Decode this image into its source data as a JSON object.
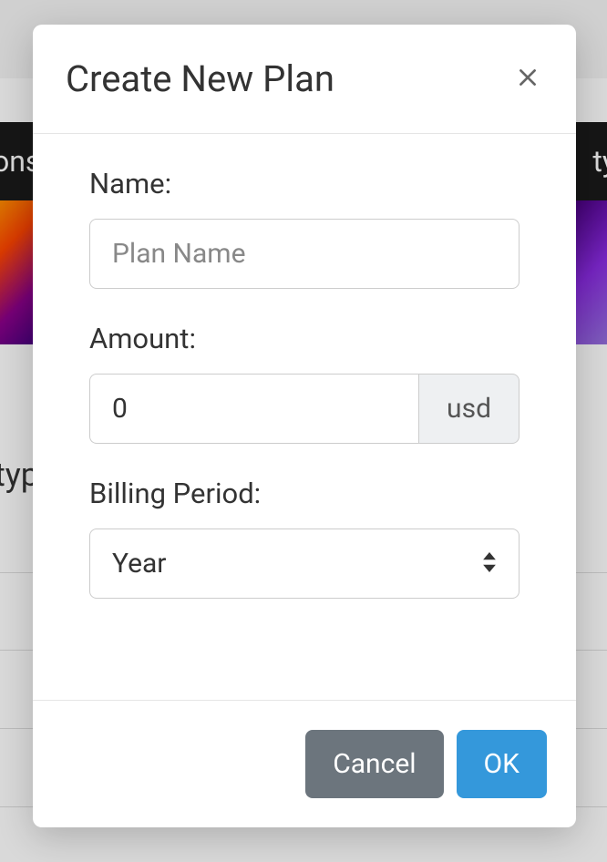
{
  "modal": {
    "title": "Create New Plan",
    "fields": {
      "name": {
        "label": "Name:",
        "placeholder": "Plan Name",
        "value": ""
      },
      "amount": {
        "label": "Amount:",
        "value": "0",
        "currency": "usd"
      },
      "billing_period": {
        "label": "Billing Period:",
        "value": "Year"
      }
    },
    "buttons": {
      "cancel": "Cancel",
      "ok": "OK"
    }
  },
  "background": {
    "nav_left": "ons",
    "nav_right": "ty",
    "text_left": "typ"
  }
}
